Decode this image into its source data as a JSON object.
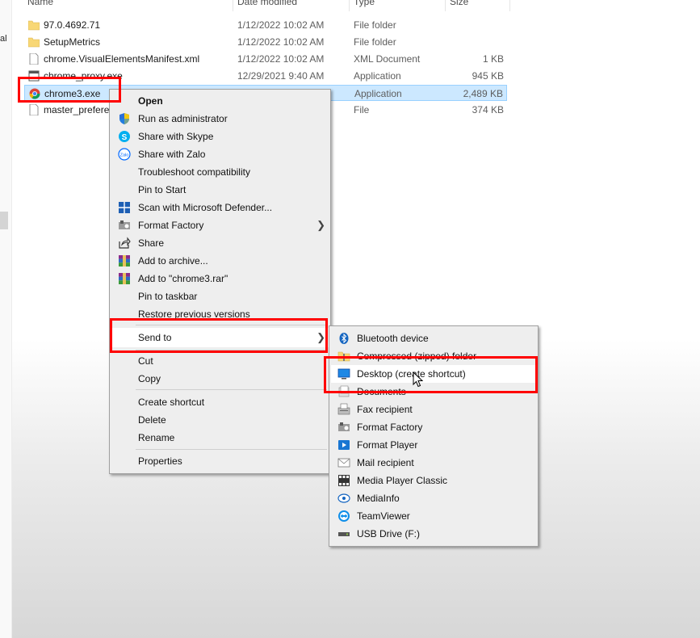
{
  "columns": {
    "name": "Name",
    "date": "Date modified",
    "type": "Type",
    "size": "Size"
  },
  "left_fragment": "al",
  "files": [
    {
      "name": "97.0.4692.71",
      "date": "1/12/2022 10:02 AM",
      "type": "File folder",
      "size": "",
      "icon": "folder-icon"
    },
    {
      "name": "SetupMetrics",
      "date": "1/12/2022 10:02 AM",
      "type": "File folder",
      "size": "",
      "icon": "folder-icon"
    },
    {
      "name": "chrome.VisualElementsManifest.xml",
      "date": "1/12/2022 10:02 AM",
      "type": "XML Document",
      "size": "1 KB",
      "icon": "document-icon"
    },
    {
      "name": "chrome_proxy.exe",
      "date": "12/29/2021 9:40 AM",
      "type": "Application",
      "size": "945 KB",
      "icon": "application-icon"
    },
    {
      "name": "chrome3.exe",
      "date": "",
      "type": "Application",
      "size": "2,489 KB",
      "icon": "chrome-icon",
      "selected": true
    },
    {
      "name": "master_preferences",
      "date": "",
      "type": "File",
      "size": "374 KB",
      "icon": "document-icon"
    }
  ],
  "context_menu": {
    "items": [
      {
        "label": "Open",
        "bold": true,
        "icon": ""
      },
      {
        "label": "Run as administrator",
        "icon": "shield-icon"
      },
      {
        "label": "Share with Skype",
        "icon": "skype-icon"
      },
      {
        "label": "Share with Zalo",
        "icon": "zalo-icon"
      },
      {
        "label": "Troubleshoot compatibility",
        "icon": ""
      },
      {
        "label": "Pin to Start",
        "icon": ""
      },
      {
        "label": "Scan with Microsoft Defender...",
        "icon": "defender-icon"
      },
      {
        "label": "Format Factory",
        "icon": "format-factory-icon",
        "submenu": true
      },
      {
        "label": "Share",
        "icon": "share-icon"
      },
      {
        "label": "Add to archive...",
        "icon": "winrar-icon"
      },
      {
        "label": "Add to \"chrome3.rar\"",
        "icon": "winrar-icon"
      },
      {
        "label": "Pin to taskbar",
        "icon": ""
      },
      {
        "label": "Restore previous versions",
        "icon": ""
      },
      {
        "label": "Send to",
        "icon": "",
        "submenu": true
      },
      {
        "label": "Cut",
        "icon": ""
      },
      {
        "label": "Copy",
        "icon": ""
      },
      {
        "label": "Create shortcut",
        "icon": ""
      },
      {
        "label": "Delete",
        "icon": ""
      },
      {
        "label": "Rename",
        "icon": ""
      },
      {
        "label": "Properties",
        "icon": ""
      }
    ]
  },
  "send_to_menu": {
    "items": [
      {
        "label": "Bluetooth device",
        "icon": "bluetooth-icon"
      },
      {
        "label": "Compressed (zipped) folder",
        "icon": "zip-folder-icon"
      },
      {
        "label": "Desktop (create shortcut)",
        "icon": "desktop-icon"
      },
      {
        "label": "Documents",
        "icon": "documents-icon"
      },
      {
        "label": "Fax recipient",
        "icon": "fax-icon"
      },
      {
        "label": "Format Factory",
        "icon": "format-factory-icon"
      },
      {
        "label": "Format Player",
        "icon": "format-player-icon"
      },
      {
        "label": "Mail recipient",
        "icon": "mail-icon"
      },
      {
        "label": "Media Player Classic",
        "icon": "media-player-icon"
      },
      {
        "label": "MediaInfo",
        "icon": "mediainfo-icon"
      },
      {
        "label": "TeamViewer",
        "icon": "teamviewer-icon"
      },
      {
        "label": "USB Drive (F:)",
        "icon": "usb-drive-icon"
      }
    ]
  },
  "colors": {
    "highlight_box": "#ff0000",
    "selection": "#cce8ff"
  }
}
